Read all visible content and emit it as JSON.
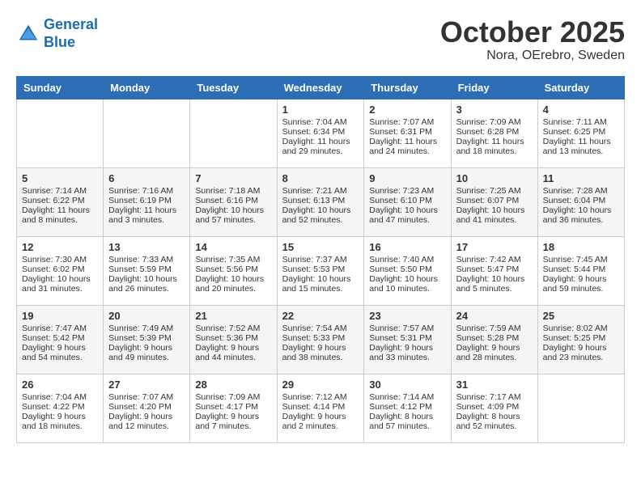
{
  "header": {
    "logo_line1": "General",
    "logo_line2": "Blue",
    "month": "October 2025",
    "location": "Nora, OErebro, Sweden"
  },
  "days_of_week": [
    "Sunday",
    "Monday",
    "Tuesday",
    "Wednesday",
    "Thursday",
    "Friday",
    "Saturday"
  ],
  "weeks": [
    [
      {
        "day": "",
        "info": ""
      },
      {
        "day": "",
        "info": ""
      },
      {
        "day": "",
        "info": ""
      },
      {
        "day": "1",
        "info": "Sunrise: 7:04 AM\nSunset: 6:34 PM\nDaylight: 11 hours\nand 29 minutes."
      },
      {
        "day": "2",
        "info": "Sunrise: 7:07 AM\nSunset: 6:31 PM\nDaylight: 11 hours\nand 24 minutes."
      },
      {
        "day": "3",
        "info": "Sunrise: 7:09 AM\nSunset: 6:28 PM\nDaylight: 11 hours\nand 18 minutes."
      },
      {
        "day": "4",
        "info": "Sunrise: 7:11 AM\nSunset: 6:25 PM\nDaylight: 11 hours\nand 13 minutes."
      }
    ],
    [
      {
        "day": "5",
        "info": "Sunrise: 7:14 AM\nSunset: 6:22 PM\nDaylight: 11 hours\nand 8 minutes."
      },
      {
        "day": "6",
        "info": "Sunrise: 7:16 AM\nSunset: 6:19 PM\nDaylight: 11 hours\nand 3 minutes."
      },
      {
        "day": "7",
        "info": "Sunrise: 7:18 AM\nSunset: 6:16 PM\nDaylight: 10 hours\nand 57 minutes."
      },
      {
        "day": "8",
        "info": "Sunrise: 7:21 AM\nSunset: 6:13 PM\nDaylight: 10 hours\nand 52 minutes."
      },
      {
        "day": "9",
        "info": "Sunrise: 7:23 AM\nSunset: 6:10 PM\nDaylight: 10 hours\nand 47 minutes."
      },
      {
        "day": "10",
        "info": "Sunrise: 7:25 AM\nSunset: 6:07 PM\nDaylight: 10 hours\nand 41 minutes."
      },
      {
        "day": "11",
        "info": "Sunrise: 7:28 AM\nSunset: 6:04 PM\nDaylight: 10 hours\nand 36 minutes."
      }
    ],
    [
      {
        "day": "12",
        "info": "Sunrise: 7:30 AM\nSunset: 6:02 PM\nDaylight: 10 hours\nand 31 minutes."
      },
      {
        "day": "13",
        "info": "Sunrise: 7:33 AM\nSunset: 5:59 PM\nDaylight: 10 hours\nand 26 minutes."
      },
      {
        "day": "14",
        "info": "Sunrise: 7:35 AM\nSunset: 5:56 PM\nDaylight: 10 hours\nand 20 minutes."
      },
      {
        "day": "15",
        "info": "Sunrise: 7:37 AM\nSunset: 5:53 PM\nDaylight: 10 hours\nand 15 minutes."
      },
      {
        "day": "16",
        "info": "Sunrise: 7:40 AM\nSunset: 5:50 PM\nDaylight: 10 hours\nand 10 minutes."
      },
      {
        "day": "17",
        "info": "Sunrise: 7:42 AM\nSunset: 5:47 PM\nDaylight: 10 hours\nand 5 minutes."
      },
      {
        "day": "18",
        "info": "Sunrise: 7:45 AM\nSunset: 5:44 PM\nDaylight: 9 hours\nand 59 minutes."
      }
    ],
    [
      {
        "day": "19",
        "info": "Sunrise: 7:47 AM\nSunset: 5:42 PM\nDaylight: 9 hours\nand 54 minutes."
      },
      {
        "day": "20",
        "info": "Sunrise: 7:49 AM\nSunset: 5:39 PM\nDaylight: 9 hours\nand 49 minutes."
      },
      {
        "day": "21",
        "info": "Sunrise: 7:52 AM\nSunset: 5:36 PM\nDaylight: 9 hours\nand 44 minutes."
      },
      {
        "day": "22",
        "info": "Sunrise: 7:54 AM\nSunset: 5:33 PM\nDaylight: 9 hours\nand 38 minutes."
      },
      {
        "day": "23",
        "info": "Sunrise: 7:57 AM\nSunset: 5:31 PM\nDaylight: 9 hours\nand 33 minutes."
      },
      {
        "day": "24",
        "info": "Sunrise: 7:59 AM\nSunset: 5:28 PM\nDaylight: 9 hours\nand 28 minutes."
      },
      {
        "day": "25",
        "info": "Sunrise: 8:02 AM\nSunset: 5:25 PM\nDaylight: 9 hours\nand 23 minutes."
      }
    ],
    [
      {
        "day": "26",
        "info": "Sunrise: 7:04 AM\nSunset: 4:22 PM\nDaylight: 9 hours\nand 18 minutes."
      },
      {
        "day": "27",
        "info": "Sunrise: 7:07 AM\nSunset: 4:20 PM\nDaylight: 9 hours\nand 12 minutes."
      },
      {
        "day": "28",
        "info": "Sunrise: 7:09 AM\nSunset: 4:17 PM\nDaylight: 9 hours\nand 7 minutes."
      },
      {
        "day": "29",
        "info": "Sunrise: 7:12 AM\nSunset: 4:14 PM\nDaylight: 9 hours\nand 2 minutes."
      },
      {
        "day": "30",
        "info": "Sunrise: 7:14 AM\nSunset: 4:12 PM\nDaylight: 8 hours\nand 57 minutes."
      },
      {
        "day": "31",
        "info": "Sunrise: 7:17 AM\nSunset: 4:09 PM\nDaylight: 8 hours\nand 52 minutes."
      },
      {
        "day": "",
        "info": ""
      }
    ]
  ]
}
